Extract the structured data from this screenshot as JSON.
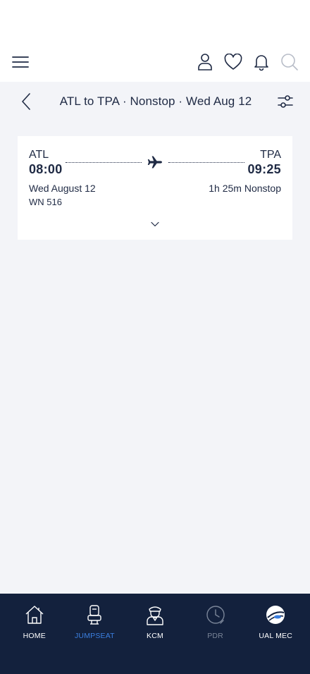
{
  "header": {
    "menu_icon": "hamburger-menu-icon",
    "icons": [
      "user-icon",
      "heart-icon",
      "bell-icon",
      "search-icon"
    ]
  },
  "title_bar": {
    "title": "ATL to TPA · Nonstop · Wed Aug 12",
    "back_icon": "chevron-left-icon",
    "filter_icon": "filter-sliders-icon"
  },
  "flight": {
    "origin": "ATL",
    "destination": "TPA",
    "depart_time": "08:00",
    "arrive_time": "09:25",
    "date": "Wed August 12",
    "duration": "1h 25m Nonstop",
    "flight_number": "WN 516"
  },
  "bottom_nav": {
    "items": [
      {
        "label": "HOME",
        "icon": "home-icon"
      },
      {
        "label": "JUMPSEAT",
        "icon": "seat-icon"
      },
      {
        "label": "KCM",
        "icon": "pilot-icon"
      },
      {
        "label": "PDR",
        "icon": "clock-icon"
      },
      {
        "label": "UAL MEC",
        "icon": "ual-mec-logo-icon"
      }
    ],
    "active": "JUMPSEAT"
  },
  "colors": {
    "navy": "#1f2a44",
    "nav_bg": "#13213d",
    "active_blue": "#3b7fe0",
    "background": "#f3f4f8"
  }
}
